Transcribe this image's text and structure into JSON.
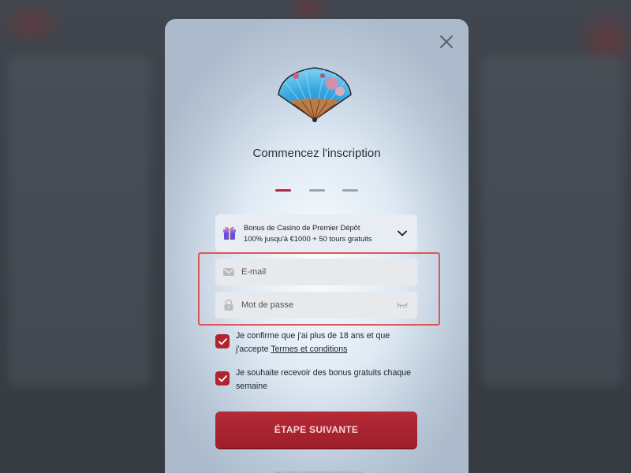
{
  "modal": {
    "title": "Commencez l'inscription",
    "steps": [
      {
        "state": "active"
      },
      {
        "state": "pending"
      },
      {
        "state": "pending"
      }
    ],
    "close_icon": "close-icon"
  },
  "bonus": {
    "icon": "gift-icon",
    "line1": "Bonus de Casino de Premier Dépôt",
    "line2": "100% jusqu'à €1000 + 50 tours gratuits",
    "chevron_icon": "chevron-down-icon"
  },
  "form": {
    "email": {
      "placeholder": "E-mail",
      "value": "",
      "icon": "envelope-icon"
    },
    "password": {
      "placeholder": "Mot de passe",
      "value": "",
      "icon": "lock-icon",
      "toggle_icon": "eye-closed-icon"
    }
  },
  "consents": {
    "age": {
      "text": "Je confirme que j'ai plus de 18 ans et que j'accepte ",
      "link": "Termes et conditions",
      "checked": true
    },
    "bonus": {
      "text": "Je souhaite recevoir des bonus gratuits chaque semaine",
      "checked": true
    }
  },
  "actions": {
    "next_label": "ÉTAPE SUIVANTE"
  },
  "colors": {
    "accent": "#b3283a",
    "highlight": "#e05555"
  }
}
